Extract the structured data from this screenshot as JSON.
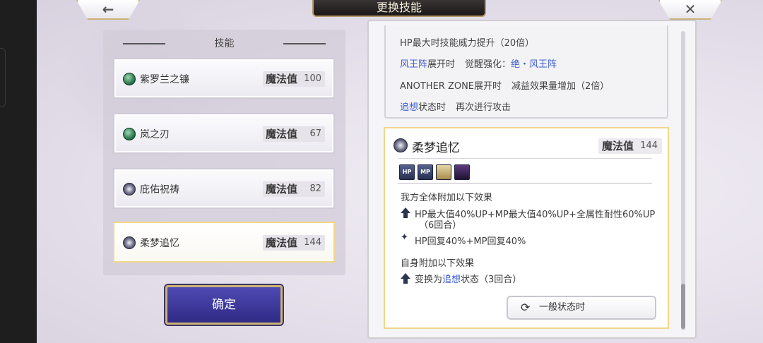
{
  "header": {
    "title": "更换技能",
    "back_icon": "←",
    "close_icon": "✕"
  },
  "skill_panel": {
    "title": "技能",
    "mp_label": "魔法值",
    "skills": [
      {
        "name": "紫罗兰之镰",
        "mp": "100",
        "icon": "wind-orb-icon"
      },
      {
        "name": "岚之刃",
        "mp": "67",
        "icon": "wind-orb-icon"
      },
      {
        "name": "庇佑祝祷",
        "mp": "82",
        "icon": "star-orb-icon"
      },
      {
        "name": "柔梦追忆",
        "mp": "144",
        "icon": "star-orb-icon"
      }
    ],
    "selected_index": 3,
    "confirm_label": "确定"
  },
  "prev_card": {
    "line1": "HP最大时技能威力提升（20倍）",
    "line2_link": "风王阵",
    "line2_text": "展开时",
    "line2_label": "觉醒强化：",
    "line2_link2": "绝・风王阵",
    "line3_a": "ANOTHER ZONE展开时",
    "line3_b": "减益效果量增加（2倍）",
    "line4_link": "追想",
    "line4_text": "状态时",
    "line4_b": "再次进行攻击"
  },
  "detail": {
    "name": "柔梦追忆",
    "mp_label": "魔法值",
    "mp": "144",
    "badges": [
      "HP",
      "MP",
      "",
      ""
    ],
    "section1_title": "我方全体附加以下效果",
    "effect1_line1": "HP最大值40%UP+MP最大值40%UP+全属性耐性60%UP",
    "effect1_line2": "（6回合）",
    "effect2": "HP回复40%+MP回复40%",
    "section2_title": "自身附加以下效果",
    "effect3_pre": "变换为",
    "effect3_link": "追想",
    "effect3_post": "状态（3回合）",
    "status_button": "一般状态时",
    "status_icon": "⟳"
  }
}
